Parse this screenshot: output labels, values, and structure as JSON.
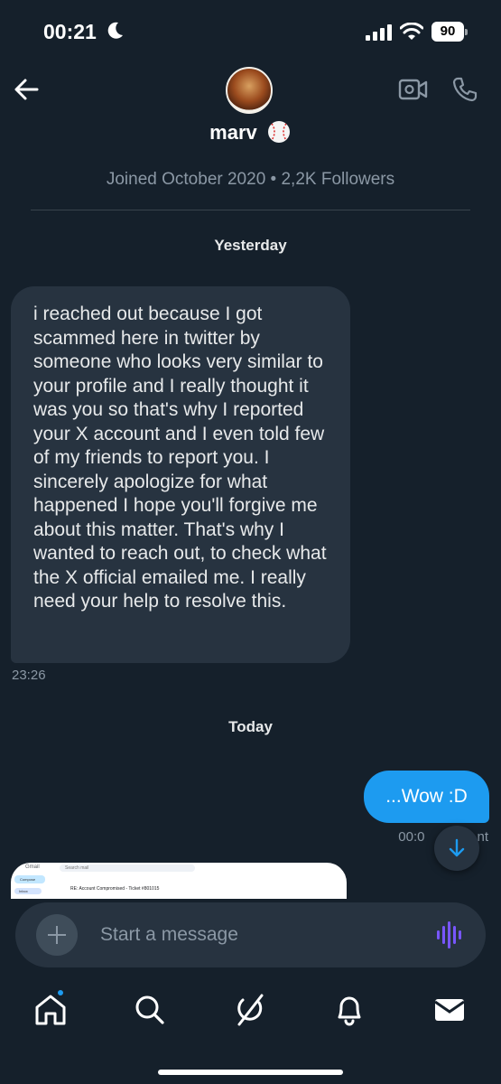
{
  "status": {
    "time": "00:21",
    "battery": "90"
  },
  "header": {
    "name": "marv",
    "meta": "Joined October 2020 • 2,2K Followers"
  },
  "thread": {
    "sep_yesterday": "Yesterday",
    "incoming_text": "i  reached out because I got scammed here in twitter by someone who looks very similar to your profile and I really thought it was you so that's why I reported your X account and I even told few of my friends to report you. I sincerely apologize for what happened I hope you'll forgive me about this matter. That's why I wanted to reach out, to check what the X official emailed me. I really need your help to resolve this.",
    "incoming_time": "23:26",
    "sep_today": "Today",
    "outgoing_text": "...Wow :D",
    "outgoing_time": "00:0",
    "outgoing_status_suffix": "nt"
  },
  "attachment_preview": {
    "app_name": "Gmail",
    "search_placeholder": "Search mail",
    "compose": "Compose",
    "inbox": "Inbox",
    "subject": "RE: Account Compromised - Ticket #801015"
  },
  "composer": {
    "placeholder": "Start a message"
  },
  "tabs": [
    "home-icon",
    "search-icon",
    "grok-icon",
    "notifications-icon",
    "messages-icon"
  ],
  "colors": {
    "background": "#15202b",
    "accent": "#1d9bf0",
    "bubble_in": "#273340",
    "muted": "#8b98a5"
  }
}
